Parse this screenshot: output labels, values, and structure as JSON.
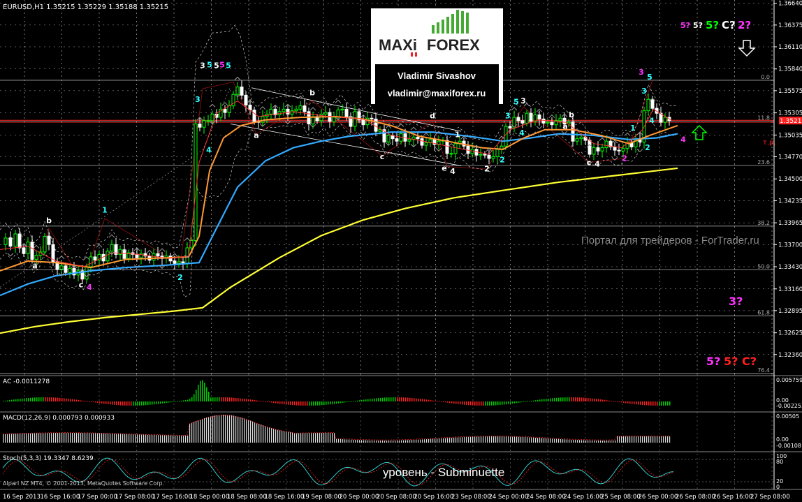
{
  "header": {
    "title": "EURUSD,H1 1.35215 1.35229 1.35188 1.35215"
  },
  "logo": {
    "brand_left": "MAXi",
    "brand_right": "FOREX",
    "author": "Vladimir Sivashov",
    "email": "vladimir@maxiforex.ru"
  },
  "watermark": "Портал для трейдеров - ForTrader.ru",
  "caption": "уровень - Subminuette",
  "copyright": "Alpari NZ MT4, © 2001-2013, MetaQuotes Software Corp.",
  "price_tag": "1.35215",
  "tp_label": "т.р.",
  "wave_forecast": {
    "top": [
      "5?",
      "5?",
      "5?",
      "C?",
      "2?"
    ],
    "mid": [
      "3?"
    ],
    "bottom": [
      "5?",
      "5?",
      "C?"
    ]
  },
  "colors": {
    "bull": "#00ff00",
    "bear": "#ffffff",
    "ma_fast": "#ff3030",
    "ma_orange": "#ff9933",
    "ma_blue": "#33aaff",
    "ma_yellow": "#ffff33",
    "wave_cyan": "#33ffff",
    "wave_magenta": "#ff33ff",
    "wave_white": "#ffffff",
    "grid": "#ffffff"
  },
  "chart_data": {
    "type": "candlestick",
    "symbol": "EURUSD",
    "timeframe": "H1",
    "ylim": [
      1.3212,
      1.3668
    ],
    "y_ticks": [
      1.3664,
      1.36375,
      1.3611,
      1.3584,
      1.35575,
      1.35305,
      1.35035,
      1.3477,
      1.345,
      1.34235,
      1.33965,
      1.337,
      1.3343,
      1.3316,
      1.32895,
      1.32625,
      1.3236
    ],
    "y_tick_labels": [
      "1.36640",
      "1.36375",
      "1.36110",
      "1.35840",
      "1.35575",
      "1.35305",
      "1.35035",
      "1.34770",
      "1.34500",
      "1.34235",
      "1.33965",
      "1.33700",
      "1.33430",
      "1.33160",
      "1.32895",
      "1.32625",
      "1.32360"
    ],
    "x_labels": [
      "16 Sep 2013",
      "16 Sep 16:00",
      "17 Sep 00:00",
      "17 Sep 08:00",
      "17 Sep 16:00",
      "18 Sep 00:00",
      "18 Sep 08:00",
      "18 Sep 16:00",
      "19 Sep 08:00",
      "20 Sep 00:00",
      "20 Sep 08:00",
      "20 Sep 16:00",
      "23 Sep 08:00",
      "24 Sep 00:00",
      "24 Sep 08:00",
      "24 Sep 16:00",
      "25 Sep 08:00",
      "26 Sep 00:00",
      "26 Sep 08:00",
      "26 Sep 16:00",
      "27 Sep 08:00"
    ],
    "fib_levels": [
      {
        "label": "0.0",
        "price": 1.35702
      },
      {
        "label": "11.8",
        "price": 1.35204
      },
      {
        "label": "23.6",
        "price": 1.34664
      },
      {
        "label": "38.2",
        "price": 1.33925
      },
      {
        "label": "50.0",
        "price": 1.33393
      },
      {
        "label": "61.8",
        "price": 1.32832
      },
      {
        "label": "76.4",
        "price": 1.32128
      }
    ],
    "current_price": 1.35215,
    "close_path": [
      [
        0,
        1.337
      ],
      [
        8,
        1.3378
      ],
      [
        15,
        1.3368
      ],
      [
        22,
        1.3383
      ],
      [
        28,
        1.3366
      ],
      [
        34,
        1.3359
      ],
      [
        40,
        1.3373
      ],
      [
        46,
        1.3352
      ],
      [
        52,
        1.3357
      ],
      [
        58,
        1.3361
      ],
      [
        64,
        1.338
      ],
      [
        70,
        1.337
      ],
      [
        76,
        1.3349
      ],
      [
        82,
        1.334
      ],
      [
        88,
        1.3344
      ],
      [
        94,
        1.3336
      ],
      [
        100,
        1.3341
      ],
      [
        106,
        1.3333
      ],
      [
        112,
        1.3338
      ],
      [
        118,
        1.3328
      ],
      [
        124,
        1.3343
      ],
      [
        130,
        1.3355
      ],
      [
        136,
        1.3351
      ],
      [
        142,
        1.3358
      ],
      [
        148,
        1.335
      ],
      [
        154,
        1.3362
      ],
      [
        160,
        1.337
      ],
      [
        166,
        1.3358
      ],
      [
        172,
        1.3364
      ],
      [
        178,
        1.3353
      ],
      [
        184,
        1.336
      ],
      [
        190,
        1.3358
      ],
      [
        196,
        1.3354
      ],
      [
        202,
        1.3359
      ],
      [
        208,
        1.3356
      ],
      [
        214,
        1.3351
      ],
      [
        220,
        1.3359
      ],
      [
        226,
        1.3356
      ],
      [
        232,
        1.3353
      ],
      [
        238,
        1.3356
      ],
      [
        244,
        1.335
      ],
      [
        250,
        1.3347
      ],
      [
        256,
        1.3349
      ],
      [
        262,
        1.3347
      ],
      [
        268,
        1.3366
      ],
      [
        274,
        1.3375
      ],
      [
        280,
        1.3517
      ],
      [
        286,
        1.3513
      ],
      [
        292,
        1.3521
      ],
      [
        298,
        1.3521
      ],
      [
        304,
        1.3529
      ],
      [
        310,
        1.3525
      ],
      [
        316,
        1.3535
      ],
      [
        322,
        1.3531
      ],
      [
        328,
        1.3539
      ],
      [
        334,
        1.3553
      ],
      [
        340,
        1.3562
      ],
      [
        346,
        1.3552
      ],
      [
        352,
        1.354
      ],
      [
        358,
        1.3534
      ],
      [
        364,
        1.352
      ],
      [
        370,
        1.3519
      ],
      [
        376,
        1.3526
      ],
      [
        382,
        1.3529
      ],
      [
        388,
        1.3535
      ],
      [
        394,
        1.3528
      ],
      [
        400,
        1.3532
      ],
      [
        406,
        1.3535
      ],
      [
        412,
        1.3529
      ],
      [
        418,
        1.3533
      ],
      [
        424,
        1.3535
      ],
      [
        430,
        1.3539
      ],
      [
        436,
        1.3532
      ],
      [
        442,
        1.3517
      ],
      [
        448,
        1.3525
      ],
      [
        454,
        1.3521
      ],
      [
        460,
        1.3529
      ],
      [
        466,
        1.3531
      ],
      [
        472,
        1.352
      ],
      [
        478,
        1.3525
      ],
      [
        484,
        1.3534
      ],
      [
        490,
        1.3535
      ],
      [
        496,
        1.3526
      ],
      [
        502,
        1.3514
      ],
      [
        508,
        1.3532
      ],
      [
        514,
        1.3522
      ],
      [
        520,
        1.3516
      ],
      [
        526,
        1.3524
      ],
      [
        532,
        1.3523
      ],
      [
        538,
        1.3508
      ],
      [
        544,
        1.351
      ],
      [
        550,
        1.3495
      ],
      [
        556,
        1.3503
      ],
      [
        562,
        1.3499
      ],
      [
        568,
        1.3496
      ],
      [
        574,
        1.3505
      ],
      [
        580,
        1.3496
      ],
      [
        586,
        1.3498
      ],
      [
        592,
        1.3501
      ],
      [
        598,
        1.3499
      ],
      [
        604,
        1.3491
      ],
      [
        610,
        1.3494
      ],
      [
        616,
        1.3498
      ],
      [
        622,
        1.3492
      ],
      [
        628,
        1.3496
      ],
      [
        634,
        1.3497
      ],
      [
        640,
        1.3481
      ],
      [
        646,
        1.3481
      ],
      [
        652,
        1.3493
      ],
      [
        658,
        1.3496
      ],
      [
        664,
        1.349
      ],
      [
        670,
        1.3481
      ],
      [
        676,
        1.3486
      ],
      [
        682,
        1.3479
      ],
      [
        688,
        1.348
      ],
      [
        694,
        1.3479
      ],
      [
        700,
        1.3475
      ],
      [
        706,
        1.3477
      ],
      [
        712,
        1.3486
      ],
      [
        718,
        1.349
      ],
      [
        724,
        1.3514
      ],
      [
        730,
        1.3512
      ],
      [
        736,
        1.3525
      ],
      [
        742,
        1.3521
      ],
      [
        748,
        1.3518
      ],
      [
        754,
        1.353
      ],
      [
        760,
        1.352
      ],
      [
        766,
        1.3528
      ],
      [
        772,
        1.3523
      ],
      [
        778,
        1.3518
      ],
      [
        784,
        1.3519
      ],
      [
        790,
        1.3516
      ],
      [
        796,
        1.3521
      ],
      [
        802,
        1.3524
      ],
      [
        808,
        1.3517
      ],
      [
        814,
        1.3519
      ],
      [
        820,
        1.3496
      ],
      [
        826,
        1.3499
      ],
      [
        832,
        1.3501
      ],
      [
        838,
        1.3497
      ],
      [
        844,
        1.348
      ],
      [
        850,
        1.3488
      ],
      [
        856,
        1.3484
      ],
      [
        862,
        1.3488
      ],
      [
        868,
        1.3496
      ],
      [
        874,
        1.3489
      ],
      [
        880,
        1.3485
      ],
      [
        886,
        1.3484
      ],
      [
        892,
        1.3487
      ],
      [
        898,
        1.3494
      ],
      [
        904,
        1.3489
      ],
      [
        910,
        1.3499
      ],
      [
        916,
        1.3495
      ],
      [
        922,
        1.3533
      ],
      [
        928,
        1.3547
      ],
      [
        934,
        1.3536
      ],
      [
        940,
        1.353
      ],
      [
        946,
        1.3519
      ],
      [
        952,
        1.3525
      ],
      [
        958,
        1.3521
      ]
    ],
    "ma_fast": [
      [
        0,
        1.3364
      ],
      [
        40,
        1.3368
      ],
      [
        80,
        1.335
      ],
      [
        120,
        1.3343
      ],
      [
        160,
        1.336
      ],
      [
        200,
        1.3358
      ],
      [
        240,
        1.3353
      ],
      [
        270,
        1.3356
      ],
      [
        285,
        1.347
      ],
      [
        310,
        1.353
      ],
      [
        340,
        1.3545
      ],
      [
        370,
        1.3526
      ],
      [
        420,
        1.3532
      ],
      [
        470,
        1.3526
      ],
      [
        520,
        1.3523
      ],
      [
        560,
        1.3503
      ],
      [
        600,
        1.3497
      ],
      [
        640,
        1.349
      ],
      [
        700,
        1.348
      ],
      [
        730,
        1.351
      ],
      [
        770,
        1.3522
      ],
      [
        810,
        1.3519
      ],
      [
        850,
        1.3493
      ],
      [
        890,
        1.3488
      ],
      [
        920,
        1.351
      ],
      [
        935,
        1.3535
      ],
      [
        960,
        1.3522
      ]
    ],
    "ma_orange": [
      [
        0,
        1.3338
      ],
      [
        40,
        1.335
      ],
      [
        80,
        1.3348
      ],
      [
        130,
        1.3342
      ],
      [
        180,
        1.3352
      ],
      [
        240,
        1.3354
      ],
      [
        270,
        1.3355
      ],
      [
        285,
        1.338
      ],
      [
        300,
        1.346
      ],
      [
        320,
        1.35
      ],
      [
        345,
        1.3515
      ],
      [
        380,
        1.3522
      ],
      [
        430,
        1.3525
      ],
      [
        480,
        1.3526
      ],
      [
        520,
        1.3523
      ],
      [
        560,
        1.3515
      ],
      [
        600,
        1.3502
      ],
      [
        640,
        1.3496
      ],
      [
        690,
        1.3488
      ],
      [
        720,
        1.3486
      ],
      [
        750,
        1.35
      ],
      [
        780,
        1.351
      ],
      [
        820,
        1.351
      ],
      [
        860,
        1.3503
      ],
      [
        900,
        1.3493
      ],
      [
        930,
        1.3503
      ],
      [
        970,
        1.3515
      ]
    ],
    "ma_blue": [
      [
        0,
        1.3308
      ],
      [
        40,
        1.3322
      ],
      [
        80,
        1.3332
      ],
      [
        130,
        1.3338
      ],
      [
        180,
        1.3342
      ],
      [
        240,
        1.3345
      ],
      [
        285,
        1.3348
      ],
      [
        310,
        1.339
      ],
      [
        340,
        1.344
      ],
      [
        380,
        1.3472
      ],
      [
        420,
        1.3488
      ],
      [
        460,
        1.3496
      ],
      [
        500,
        1.3502
      ],
      [
        560,
        1.3507
      ],
      [
        620,
        1.3507
      ],
      [
        680,
        1.3501
      ],
      [
        720,
        1.3496
      ],
      [
        760,
        1.35
      ],
      [
        800,
        1.3505
      ],
      [
        850,
        1.3503
      ],
      [
        900,
        1.3498
      ],
      [
        940,
        1.35
      ],
      [
        970,
        1.3505
      ]
    ],
    "ma_yellow": [
      [
        0,
        1.3262
      ],
      [
        50,
        1.327
      ],
      [
        100,
        1.3276
      ],
      [
        150,
        1.3281
      ],
      [
        200,
        1.3285
      ],
      [
        250,
        1.3289
      ],
      [
        290,
        1.3293
      ],
      [
        330,
        1.3318
      ],
      [
        400,
        1.3354
      ],
      [
        460,
        1.3381
      ],
      [
        520,
        1.34
      ],
      [
        580,
        1.3414
      ],
      [
        650,
        1.3427
      ],
      [
        720,
        1.3436
      ],
      [
        800,
        1.3446
      ],
      [
        860,
        1.3452
      ],
      [
        920,
        1.3458
      ],
      [
        970,
        1.3463
      ]
    ],
    "wave_labels": [
      {
        "t": "b",
        "x": 70,
        "p": 1.3396,
        "c": "w"
      },
      {
        "t": "1",
        "x": 150,
        "p": 1.3409,
        "c": "c"
      },
      {
        "t": "a",
        "x": 50,
        "p": 1.3341,
        "c": "w"
      },
      {
        "t": "c",
        "x": 116,
        "p": 1.3318,
        "c": "w"
      },
      {
        "t": "4",
        "x": 128,
        "p": 1.3315,
        "c": "m"
      },
      {
        "t": "2",
        "x": 258,
        "p": 1.3327,
        "c": "c"
      },
      {
        "t": "3",
        "x": 290,
        "p": 1.3585,
        "c": "w"
      },
      {
        "t": "5",
        "x": 300,
        "p": 1.3586,
        "c": "c"
      },
      {
        "t": "5",
        "x": 310,
        "p": 1.3585,
        "c": "w"
      },
      {
        "t": "5",
        "x": 318,
        "p": 1.3586,
        "c": "m"
      },
      {
        "t": "5",
        "x": 327,
        "p": 1.3585,
        "c": "c"
      },
      {
        "t": "3",
        "x": 283,
        "p": 1.3544,
        "c": "c"
      },
      {
        "t": "4",
        "x": 299,
        "p": 1.3482,
        "c": "c"
      },
      {
        "t": "a",
        "x": 367,
        "p": 1.35,
        "c": "w"
      },
      {
        "t": "b",
        "x": 447,
        "p": 1.3552,
        "c": "w"
      },
      {
        "t": "c",
        "x": 547,
        "p": 1.3474,
        "c": "w"
      },
      {
        "t": "d",
        "x": 619,
        "p": 1.3524,
        "c": "w"
      },
      {
        "t": "1",
        "x": 655,
        "p": 1.3501,
        "c": "w"
      },
      {
        "t": "e",
        "x": 636,
        "p": 1.346,
        "c": "w"
      },
      {
        "t": "4",
        "x": 648,
        "p": 1.3456,
        "c": "w"
      },
      {
        "t": "2",
        "x": 697,
        "p": 1.3459,
        "c": "w"
      },
      {
        "t": "2",
        "x": 719,
        "p": 1.347,
        "c": "c"
      },
      {
        "t": "3",
        "x": 727,
        "p": 1.3524,
        "c": "c"
      },
      {
        "t": "5",
        "x": 739,
        "p": 1.3541,
        "c": "c"
      },
      {
        "t": "3",
        "x": 749,
        "p": 1.3542,
        "c": "w"
      },
      {
        "t": "4",
        "x": 747,
        "p": 1.3503,
        "c": "c"
      },
      {
        "t": "b",
        "x": 818,
        "p": 1.3525,
        "c": "w"
      },
      {
        "t": "a",
        "x": 809,
        "p": 1.3511,
        "c": "w"
      },
      {
        "t": "c",
        "x": 843,
        "p": 1.3467,
        "c": "w"
      },
      {
        "t": "4",
        "x": 855,
        "p": 1.3465,
        "c": "w"
      },
      {
        "t": "2",
        "x": 894,
        "p": 1.3472,
        "c": "m"
      },
      {
        "t": "1",
        "x": 906,
        "p": 1.3509,
        "c": "c"
      },
      {
        "t": "2",
        "x": 927,
        "p": 1.3485,
        "c": "c"
      },
      {
        "t": "3",
        "x": 918,
        "p": 1.3577,
        "c": "m"
      },
      {
        "t": "5",
        "x": 930,
        "p": 1.3571,
        "c": "c"
      },
      {
        "t": "3",
        "x": 922,
        "p": 1.3554,
        "c": "c"
      },
      {
        "t": "4",
        "x": 933,
        "p": 1.3518,
        "c": "c"
      },
      {
        "t": "4",
        "x": 978,
        "p": 1.3495,
        "c": "m"
      }
    ],
    "indicators": {
      "ac": {
        "label": "AC -0.0011278",
        "ticks": [
          "0.005759",
          "0.00",
          "-0.002253"
        ]
      },
      "macd": {
        "label": "MACD(12,26,9) 0.000793 0.000933",
        "ticks": [
          "0.00505",
          "0.00",
          "-0.00108"
        ]
      },
      "stoch": {
        "label": "Stoch(5,3,3) 19.3347 8.6239",
        "ticks": [
          "100",
          "80",
          "20",
          "0"
        ]
      }
    }
  }
}
